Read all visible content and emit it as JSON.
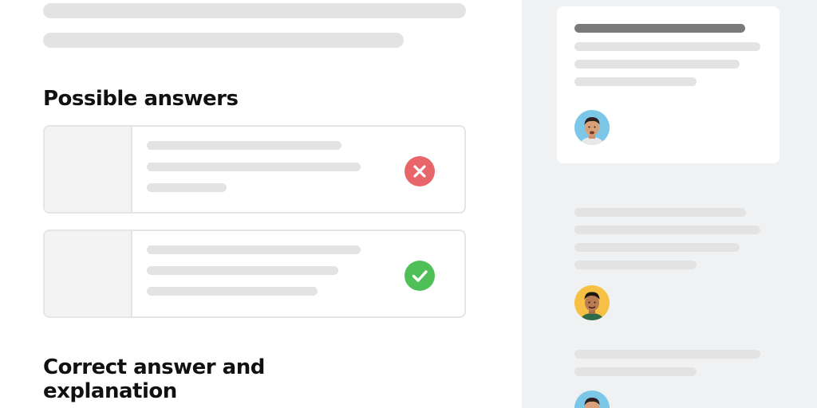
{
  "left": {
    "possible_answers_heading": "Possible answers",
    "correct_heading": "Correct answer and explanation",
    "answers": [
      {
        "status": "incorrect",
        "icon": "x-icon"
      },
      {
        "status": "correct",
        "icon": "check-icon"
      }
    ]
  },
  "colors": {
    "incorrect": "#e8666a",
    "correct": "#4fbf58",
    "sidebar_bg": "#f0f1f3",
    "placeholder": "#e3e3e3",
    "avatar_blue": "#7cc7e8",
    "avatar_yellow": "#f5c043"
  },
  "comments": [
    {
      "avatar": "avatar-blue-bg"
    },
    {
      "avatar": "avatar-yellow-bg"
    },
    {
      "avatar": "avatar-blue-bg"
    }
  ]
}
